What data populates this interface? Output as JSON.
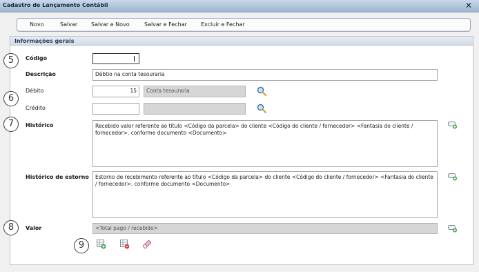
{
  "window": {
    "title": "Cadastro de Lançamento Contábil",
    "close": "✕"
  },
  "toolbar": {
    "buttons": [
      "Novo",
      "Salvar",
      "Salvar e Novo",
      "Salvar e Fechar",
      "Excluir e Fechar"
    ]
  },
  "panel": {
    "title": "Informações gerais"
  },
  "form": {
    "codigo": {
      "label": "Código",
      "value": ""
    },
    "descricao": {
      "label": "Descrição",
      "value": "Débtio na conta tesouraria"
    },
    "debito": {
      "label": "Débito",
      "value": "15",
      "account": "Conta tesouraria"
    },
    "credito": {
      "label": "Crédito",
      "value": "",
      "account": ""
    },
    "historico": {
      "label": "Histórico",
      "value": "Recebido valor referente ao título <Código da parcela> do cliente <Código do cliente / fornecedor>  <Fantasia do cliente / fornecedor>. conforme documento <Documento>"
    },
    "historico_estorno": {
      "label": "Histórico de estorno",
      "value": "Estorno de recebimento referente ao título <Código da parcela> do cliente <Código do cliente / fornecedor>  <Fantasia do cliente / fornecedor>. conforme documento <Documento>"
    },
    "valor": {
      "label": "Valor",
      "value": "<Total pago / recebido>"
    }
  },
  "callouts": {
    "c5": "5",
    "c6": "6",
    "c7": "7",
    "c8": "8",
    "c9": "9"
  },
  "icons": {
    "search": "magnifier-icon",
    "add_text": "add-field-icon",
    "grid_add": "grid-add-icon",
    "grid_remove": "grid-remove-icon",
    "eraser": "eraser-icon"
  },
  "colors": {
    "titlebar": "#9fb4cf",
    "disabled_field": "#d6d6d6",
    "accent_green": "#3a9a3a",
    "accent_red": "#d23b3b"
  }
}
